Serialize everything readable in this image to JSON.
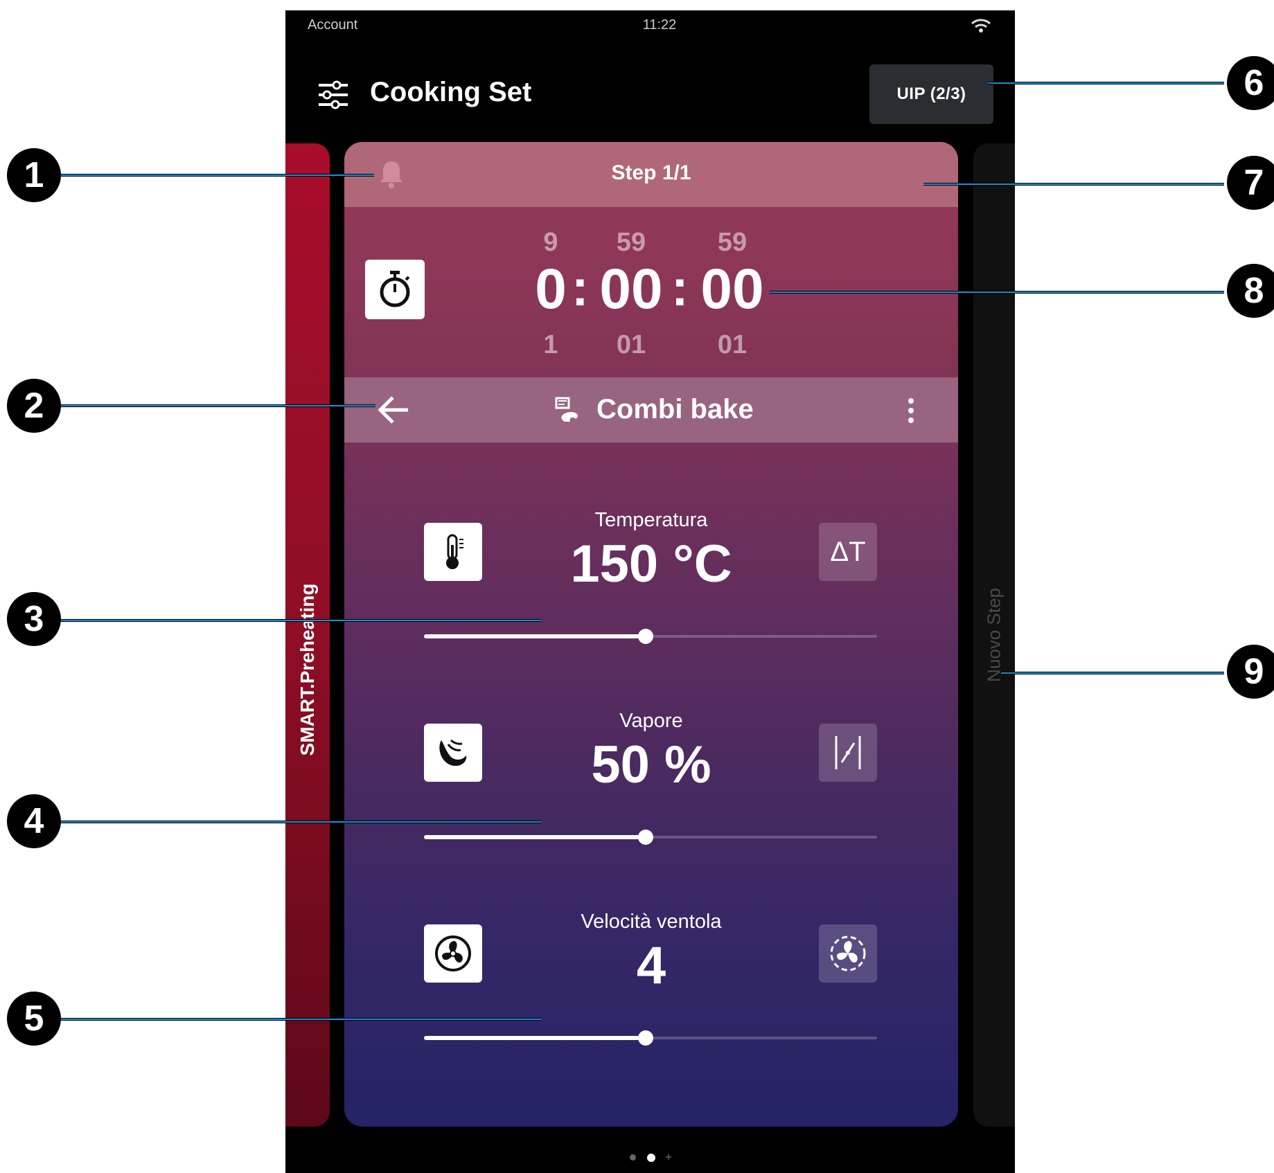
{
  "status_bar": {
    "account": "Account",
    "time": "11:22"
  },
  "header": {
    "title": "Cooking Set",
    "uip_button": "UIP (2/3)"
  },
  "side_panels": {
    "left_label": "SMART.Preheating",
    "right_label": "Nuovo Step"
  },
  "step": {
    "label": "Step 1/1"
  },
  "timer": {
    "hours": {
      "prev": "9",
      "current": "0",
      "next": "1"
    },
    "minutes": {
      "prev": "59",
      "current": "00",
      "next": "01"
    },
    "seconds": {
      "prev": "59",
      "current": "00",
      "next": "01"
    },
    "separator": ":"
  },
  "mode": {
    "label": "Combi bake"
  },
  "params": [
    {
      "label": "Temperatura",
      "value": "150 °C",
      "option": "ΔT",
      "level": 0.49
    },
    {
      "label": "Vapore",
      "value": "50 %",
      "level": 0.49
    },
    {
      "label": "Velocità ventola",
      "value": "4",
      "level": 0.49
    }
  ],
  "callouts": [
    "1",
    "2",
    "3",
    "4",
    "5",
    "6",
    "7",
    "8",
    "9"
  ],
  "colors": {
    "callout_line": "#1a8fd6",
    "card_top": "#983a5a",
    "card_bottom": "#232466",
    "step_header": "#b06878"
  }
}
